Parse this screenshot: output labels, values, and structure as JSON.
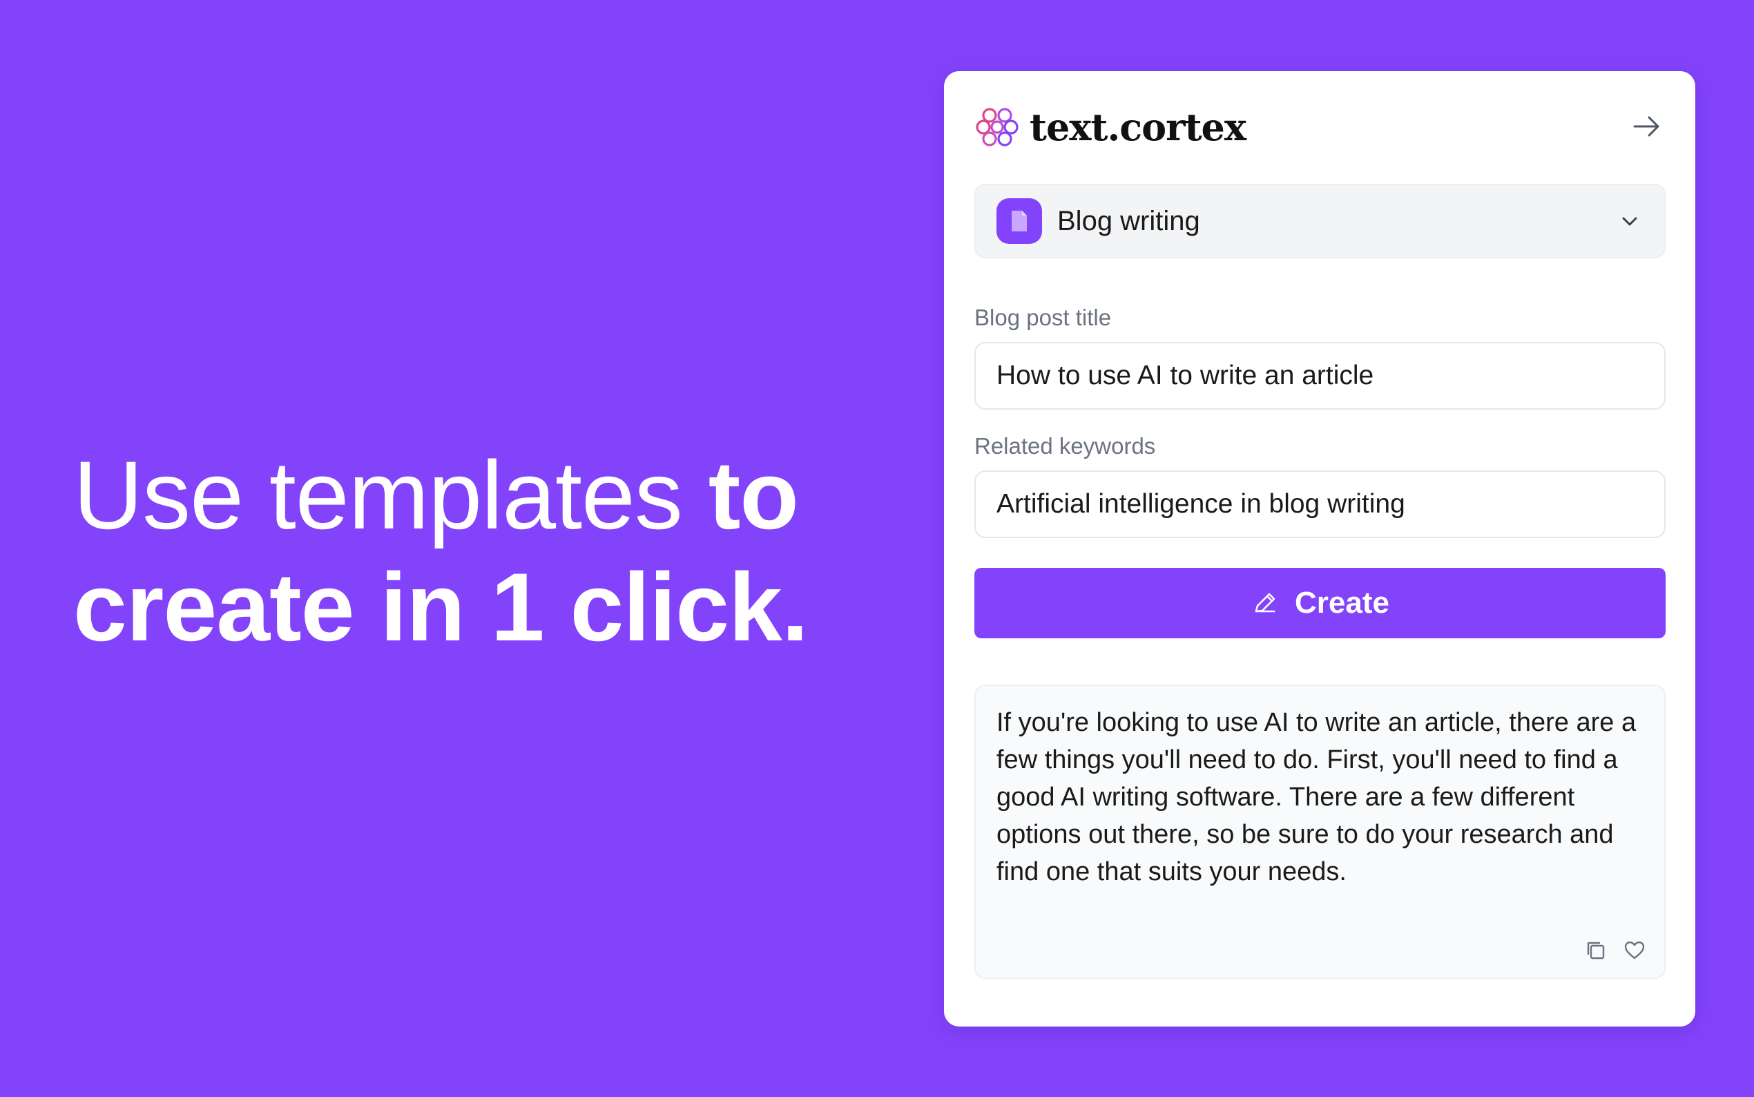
{
  "hero": {
    "line1_light": "Use templates",
    "line1_bold": "to",
    "line2_bold": "create in 1 click."
  },
  "panel": {
    "brand": "text.cortex",
    "header_icon": "arrow-right-icon",
    "template_select": {
      "icon": "document-icon",
      "selected": "Blog writing",
      "chevron": "chevron-down-icon"
    },
    "fields": [
      {
        "label": "Blog post title",
        "value": "How to use AI to write an article"
      },
      {
        "label": "Related keywords",
        "value": "Artificial intelligence in blog writing"
      }
    ],
    "create_button": {
      "icon": "pencil-icon",
      "label": "Create"
    },
    "output": {
      "text": "If you're looking to use AI to write an article, there are a few things you'll need to do. First, you'll need to find a good AI writing software. There are a few different options out there, so be sure to do your research and find one that suits your needs.",
      "actions": [
        "copy-icon",
        "heart-icon"
      ]
    }
  },
  "colors": {
    "background": "#8343FB",
    "accent": "#8343FB",
    "card": "#FFFFFF",
    "logo_pink": "#E0458A",
    "logo_purple": "#8343FB"
  }
}
